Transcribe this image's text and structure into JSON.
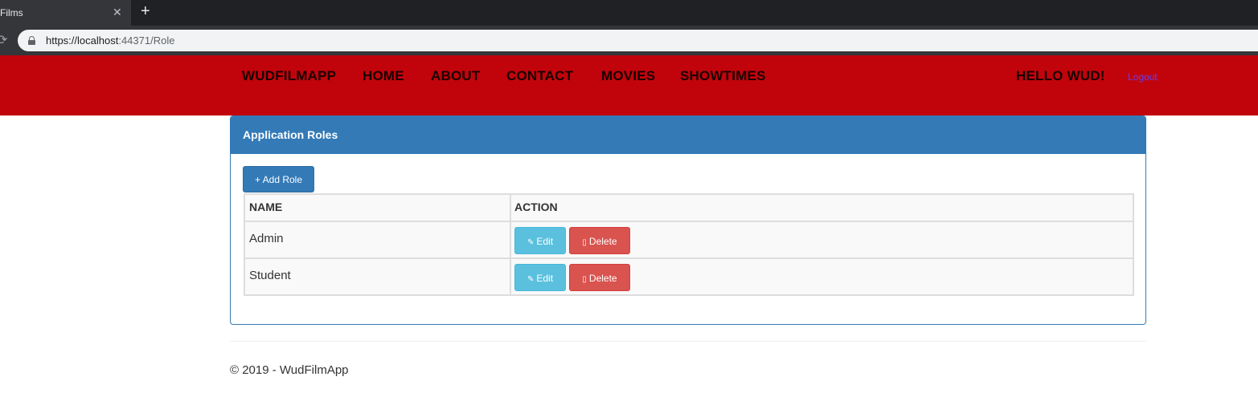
{
  "browser": {
    "tab_title": "Films",
    "tab_close": "✕",
    "new_tab": "+",
    "url_host": "https://localhost",
    "url_rest": ":44371/Role"
  },
  "nav": {
    "brand": "WUDFILMAPP",
    "items": [
      "HOME",
      "ABOUT",
      "CONTACT",
      "MOVIES",
      "SHOWTIMES"
    ],
    "greeting": "HELLO WUD!",
    "logout": "Logout"
  },
  "panel": {
    "title": "Application Roles",
    "add_button": "+ Add Role"
  },
  "table": {
    "headers": [
      "NAME",
      "ACTION"
    ],
    "rows": [
      {
        "name": "Admin",
        "edit": "Edit",
        "delete": "Delete"
      },
      {
        "name": "Student",
        "edit": "Edit",
        "delete": "Delete"
      }
    ]
  },
  "footer": {
    "text": "© 2019 - WudFilmApp"
  },
  "colors": {
    "navbar": "#c1040c",
    "primary": "#337ab7",
    "info": "#5bc0de",
    "danger": "#d9534f"
  }
}
